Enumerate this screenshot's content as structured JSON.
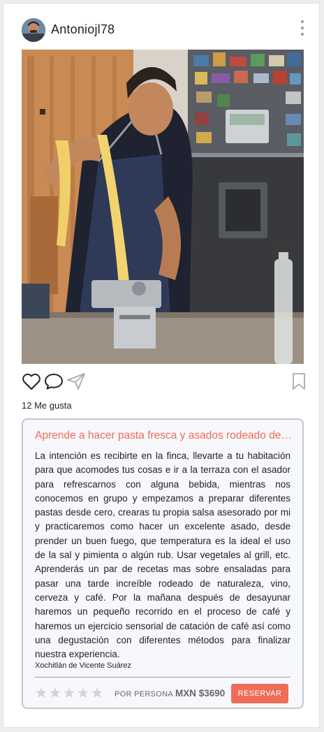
{
  "post": {
    "username": "Antoniojl78",
    "likes": "12 Me gusta"
  },
  "icons": {
    "avatar": "user-avatar",
    "more": "more-vertical-icon",
    "like": "heart-icon",
    "comment": "comment-icon",
    "share": "send-icon",
    "save": "bookmark-icon",
    "rating": "star-icon"
  },
  "experience": {
    "title": "Aprende a hacer pasta fresca y asados rodeado de naturaleza",
    "description": "La intención es recibirte en la finca, llevarte a tu habitación para que acomodes tus cosas e ir a la terraza con el asador para refrescarnos con alguna bebida, mientras nos conocemos en grupo y empezamos a preparar diferentes pastas desde cero, crearas tu propia salsa asesorado por mi y practicaremos como hacer un excelente asado, desde prender un buen fuego, que temperatura es la ideal el uso de la sal y pimienta o algún rub. Usar vegetales al grill, etc. Aprenderás un par de recetas mas sobre ensaladas para pasar una tarde increíble rodeado de naturaleza, vino, cerveza y café. Por la mañana después de desayunar haremos un pequeño recorrido en el proceso de café y haremos un ejercicio sensorial de catación de café así como una degustación con diferentes métodos para finalizar nuestra experiencia.",
    "location": "Xochitlán de Vicente Suárez",
    "rating": 0,
    "rating_max": 5,
    "per_person_label": "POR PERSONA",
    "price": "MXN $3690",
    "reserve_label": "RESERVAR"
  },
  "colors": {
    "accent": "#ef6c57",
    "card_border": "#c3c6d0",
    "card_bg": "#f7f8fc",
    "star_empty": "#d6d6d6"
  }
}
